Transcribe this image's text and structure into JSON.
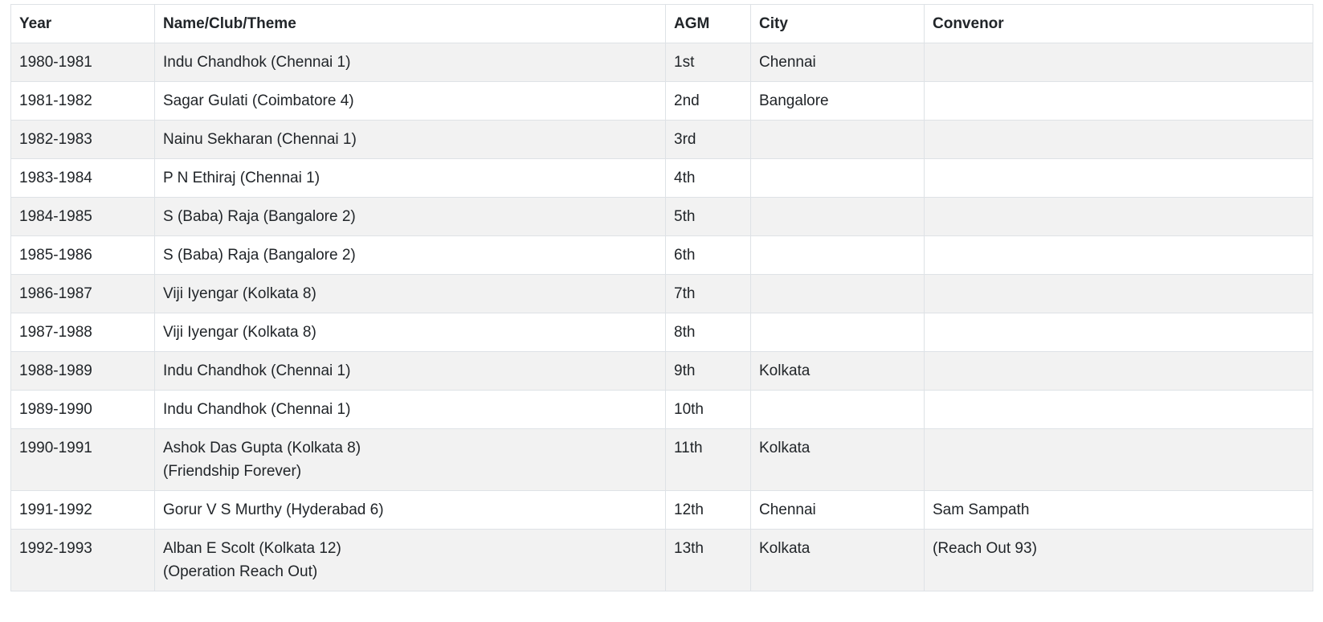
{
  "table": {
    "headers": [
      "Year",
      "Name/Club/Theme",
      "AGM",
      "City",
      "Convenor"
    ],
    "rows": [
      {
        "year": "1980-1981",
        "name": [
          "Indu Chandhok (Chennai 1)"
        ],
        "agm": "1st",
        "city": "Chennai",
        "convenor": ""
      },
      {
        "year": "1981-1982",
        "name": [
          "Sagar Gulati (Coimbatore 4)"
        ],
        "agm": "2nd",
        "city": "Bangalore",
        "convenor": ""
      },
      {
        "year": "1982-1983",
        "name": [
          "Nainu Sekharan (Chennai 1)"
        ],
        "agm": "3rd",
        "city": "",
        "convenor": ""
      },
      {
        "year": "1983-1984",
        "name": [
          "P N Ethiraj (Chennai 1)"
        ],
        "agm": "4th",
        "city": "",
        "convenor": ""
      },
      {
        "year": "1984-1985",
        "name": [
          "S (Baba) Raja (Bangalore 2)"
        ],
        "agm": "5th",
        "city": "",
        "convenor": ""
      },
      {
        "year": "1985-1986",
        "name": [
          "S (Baba) Raja (Bangalore 2)"
        ],
        "agm": "6th",
        "city": "",
        "convenor": ""
      },
      {
        "year": "1986-1987",
        "name": [
          "Viji Iyengar (Kolkata 8)"
        ],
        "agm": "7th",
        "city": "",
        "convenor": ""
      },
      {
        "year": "1987-1988",
        "name": [
          "Viji Iyengar (Kolkata 8)"
        ],
        "agm": "8th",
        "city": "",
        "convenor": ""
      },
      {
        "year": "1988-1989",
        "name": [
          "Indu Chandhok (Chennai 1)"
        ],
        "agm": "9th",
        "city": "Kolkata",
        "convenor": ""
      },
      {
        "year": "1989-1990",
        "name": [
          "Indu Chandhok (Chennai 1)"
        ],
        "agm": "10th",
        "city": "",
        "convenor": ""
      },
      {
        "year": "1990-1991",
        "name": [
          "Ashok Das Gupta (Kolkata 8)",
          "(Friendship Forever)"
        ],
        "agm": "11th",
        "city": "Kolkata",
        "convenor": ""
      },
      {
        "year": "1991-1992",
        "name": [
          "Gorur V S Murthy (Hyderabad 6)"
        ],
        "agm": "12th",
        "city": "Chennai",
        "convenor": "Sam Sampath"
      },
      {
        "year": "1992-1993",
        "name": [
          "Alban E Scolt (Kolkata 12)",
          "(Operation Reach Out)"
        ],
        "agm": "13th",
        "city": "Kolkata",
        "convenor": "(Reach Out 93)"
      }
    ]
  }
}
